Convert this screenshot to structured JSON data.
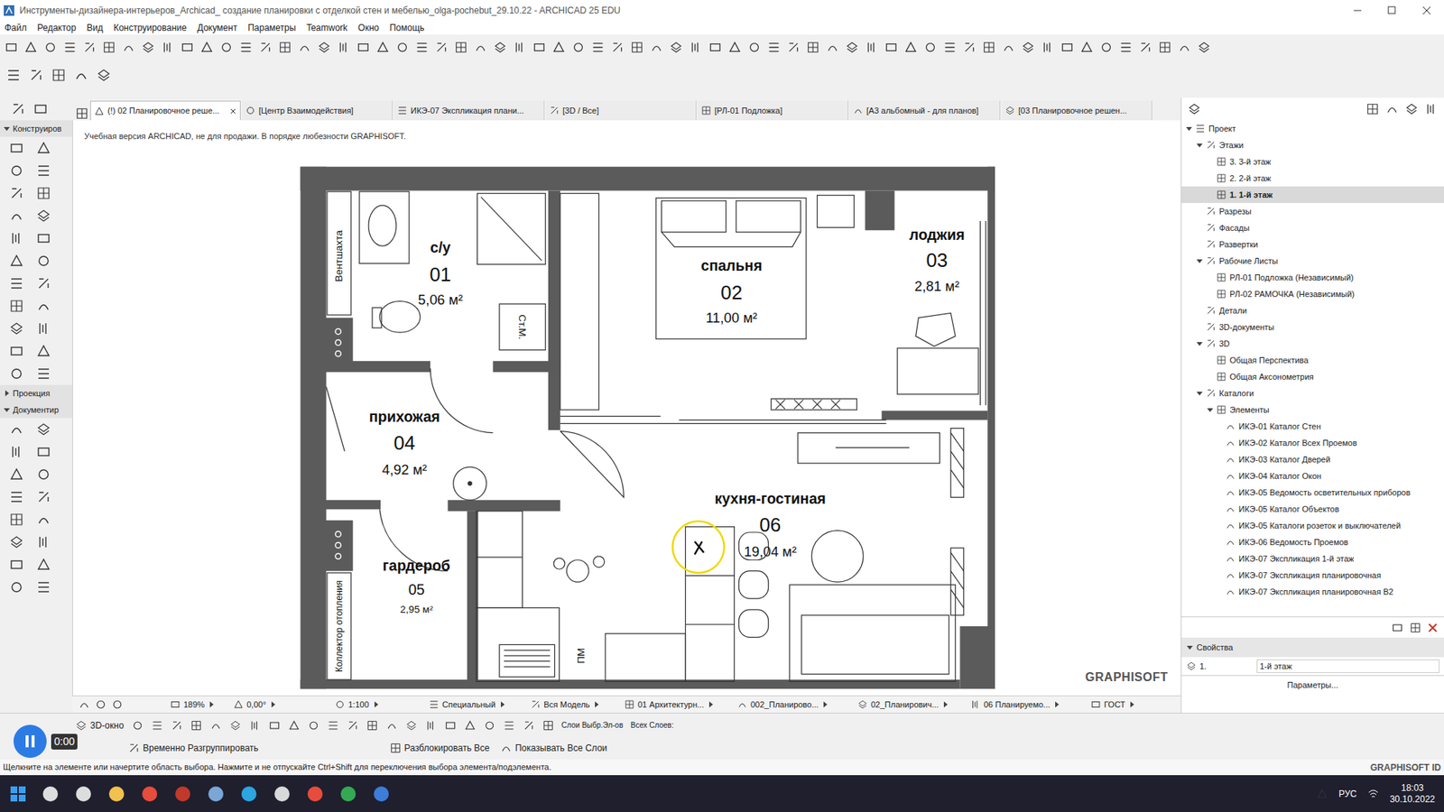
{
  "window": {
    "title": "Инструменты-дизайнера-интерьеров_Archicad_ создание планировки с отделкой стен и мебелью_olga-pochebut_29.10.22 - ARCHICAD 25 EDU"
  },
  "menu": [
    "Файл",
    "Редактор",
    "Вид",
    "Конструирование",
    "Документ",
    "Параметры",
    "Teamwork",
    "Окно",
    "Помощь"
  ],
  "tabs": [
    {
      "label": "(!) 02 Планировочное реше...",
      "selected": true
    },
    {
      "label": "[Центр Взаимодействия]",
      "selected": false
    },
    {
      "label": "ИКЭ-07 Экспликация плани...",
      "selected": false
    },
    {
      "label": "[3D / Все]",
      "selected": false
    },
    {
      "label": "[РЛ-01 Подложка]",
      "selected": false
    },
    {
      "label": "[A3 альбомный - для планов]",
      "selected": false
    },
    {
      "label": "[03 Планировочное решен...",
      "selected": false
    }
  ],
  "toolbox": {
    "sections": [
      {
        "label": "Конструиров",
        "expanded": true
      },
      {
        "label": "Проекция",
        "expanded": false
      },
      {
        "label": "Документир",
        "expanded": true
      }
    ]
  },
  "canvas": {
    "watermark": "Учебная версия ARCHICAD, не для продажи. В порядке любезности GRAPHISOFT.",
    "logo": "GRAPHISOFT",
    "rooms": [
      {
        "name": "с/у",
        "number": "01",
        "area": "5,06 м²"
      },
      {
        "name": "спальня",
        "number": "02",
        "area": "11,00 м²"
      },
      {
        "name": "лоджия",
        "number": "03",
        "area": "2,81 м²"
      },
      {
        "name": "прихожая",
        "number": "04",
        "area": "4,92 м²"
      },
      {
        "name": "гардероб",
        "number": "05",
        "area": "2,95 м²"
      },
      {
        "name": "кухня-гостиная",
        "number": "06",
        "area": "19,04 м²"
      }
    ],
    "labels": [
      "Вентшахта",
      "Ст.М.",
      "Коллектор отопления",
      "ПМ"
    ]
  },
  "navigator": {
    "tree": [
      {
        "label": "Проект",
        "level": 0,
        "expanded": true,
        "selected": false
      },
      {
        "label": "Этажи",
        "level": 1,
        "expanded": true,
        "selected": false
      },
      {
        "label": "3. 3-й этаж",
        "level": 2,
        "expanded": false,
        "selected": false
      },
      {
        "label": "2. 2-й этаж",
        "level": 2,
        "expanded": false,
        "selected": false
      },
      {
        "label": "1. 1-й этаж",
        "level": 2,
        "expanded": false,
        "selected": true
      },
      {
        "label": "Разрезы",
        "level": 1,
        "expanded": false,
        "selected": false
      },
      {
        "label": "Фасады",
        "level": 1,
        "expanded": false,
        "selected": false
      },
      {
        "label": "Развертки",
        "level": 1,
        "expanded": false,
        "selected": false
      },
      {
        "label": "Рабочие Листы",
        "level": 1,
        "expanded": true,
        "selected": false
      },
      {
        "label": "РЛ-01 Подложка (Независимый)",
        "level": 2,
        "expanded": false,
        "selected": false
      },
      {
        "label": "РЛ-02 РАМОЧКА (Независимый)",
        "level": 2,
        "expanded": false,
        "selected": false
      },
      {
        "label": "Детали",
        "level": 1,
        "expanded": false,
        "selected": false
      },
      {
        "label": "3D-документы",
        "level": 1,
        "expanded": false,
        "selected": false
      },
      {
        "label": "3D",
        "level": 1,
        "expanded": true,
        "selected": false
      },
      {
        "label": "Общая Перспектива",
        "level": 2,
        "expanded": false,
        "selected": false
      },
      {
        "label": "Общая Аксонометрия",
        "level": 2,
        "expanded": false,
        "selected": false
      },
      {
        "label": "Каталоги",
        "level": 1,
        "expanded": true,
        "selected": false
      },
      {
        "label": "Элементы",
        "level": 2,
        "expanded": true,
        "selected": false
      },
      {
        "label": "ИКЭ-01 Каталог Стен",
        "level": 3,
        "expanded": false,
        "selected": false
      },
      {
        "label": "ИКЭ-02 Каталог Всех Проемов",
        "level": 3,
        "expanded": false,
        "selected": false
      },
      {
        "label": "ИКЭ-03 Каталог Дверей",
        "level": 3,
        "expanded": false,
        "selected": false
      },
      {
        "label": "ИКЭ-04 Каталог Окон",
        "level": 3,
        "expanded": false,
        "selected": false
      },
      {
        "label": "ИКЭ-05 Ведомость осветительных приборов",
        "level": 3,
        "expanded": false,
        "selected": false
      },
      {
        "label": "ИКЭ-05 Каталог Объектов",
        "level": 3,
        "expanded": false,
        "selected": false
      },
      {
        "label": "ИКЭ-05 Каталоги розеток и выключателей",
        "level": 3,
        "expanded": false,
        "selected": false
      },
      {
        "label": "ИКЭ-06 Ведомость Проемов",
        "level": 3,
        "expanded": false,
        "selected": false
      },
      {
        "label": "ИКЭ-07 Экспликация 1-й этаж",
        "level": 3,
        "expanded": false,
        "selected": false
      },
      {
        "label": "ИКЭ-07 Экспликация планировочная",
        "level": 3,
        "expanded": false,
        "selected": false
      },
      {
        "label": "ИКЭ-07 Экспликация планировочная В2",
        "level": 3,
        "expanded": false,
        "selected": false
      }
    ],
    "properties": {
      "title": "Свойства",
      "id": "1.",
      "value": "1-й этаж",
      "button": "Параметры..."
    }
  },
  "view_bar": {
    "items": [
      "189%",
      "0,00°",
      "1:100",
      "Специальный",
      "Вся Модель",
      "01 Архитектурн...",
      "002_Планирово...",
      "02_Планирович...",
      "06 Планируемо...",
      "ГОСТ"
    ]
  },
  "layer_bar": {
    "button": "3D-окно",
    "selected_layers": "Слои Выбр.Эл-ов",
    "all_layers": "Всех Слоев:"
  },
  "edit_bar": {
    "items": [
      "Временно Разгруппировать",
      "Разблокировать Все",
      "Показывать Все Слои"
    ]
  },
  "status": {
    "hint": "Щелкните на элементе или начертите область выбора. Нажмите и не отпускайте Ctrl+Shift для переключения выбора элемента/подэлемента.",
    "brand": "GRAPHISOFT ID"
  },
  "video": {
    "time": "0:00",
    "playing": true
  },
  "taskbar": {
    "language": "РУС",
    "time": "18:03",
    "date": "30.10.2022"
  }
}
